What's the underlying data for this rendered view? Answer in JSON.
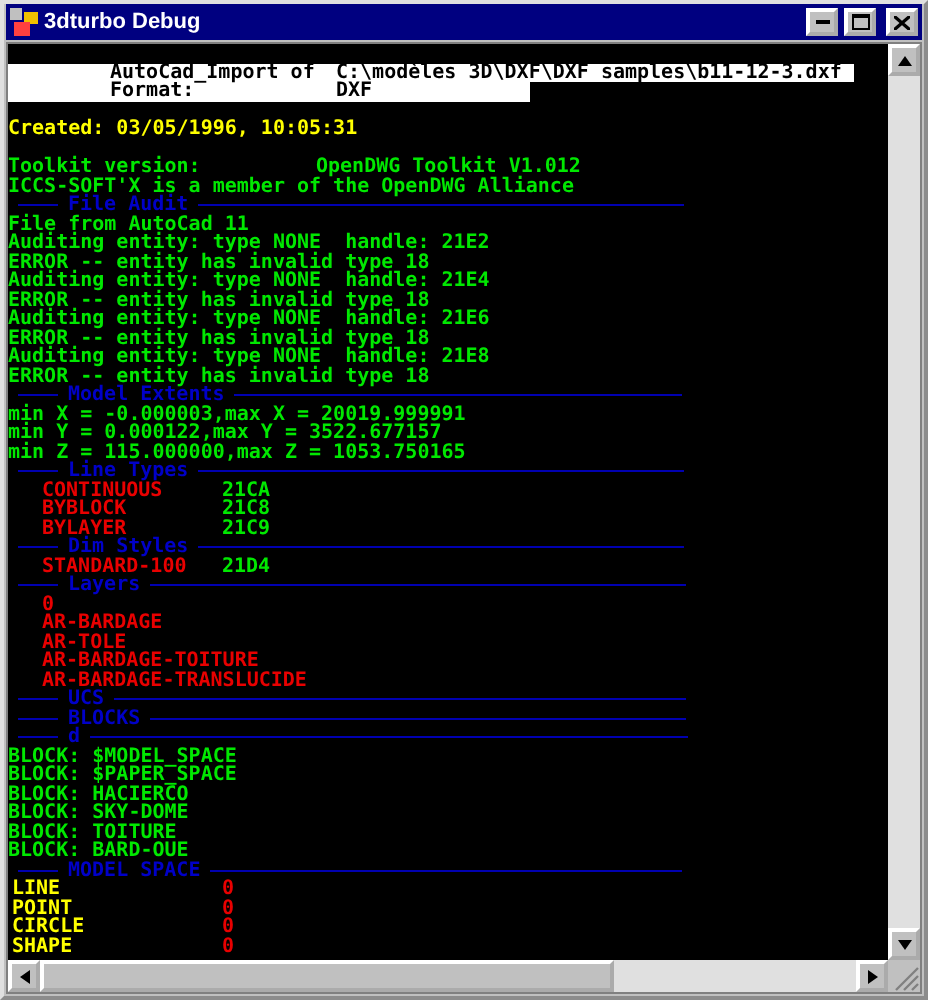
{
  "window": {
    "title": "3dturbo Debug"
  },
  "console": [
    {
      "kind": "blank"
    },
    {
      "kind": "header",
      "label": "AutoCad_Import of",
      "value": "C:\\modèles 3D\\DXF\\DXF samples\\b11-12-3.dxf"
    },
    {
      "kind": "header",
      "label": "Format:",
      "value": "DXF"
    },
    {
      "kind": "blank"
    },
    {
      "kind": "text",
      "text": "Created: 03/05/1996, 10:05:31",
      "color": "#ffff00"
    },
    {
      "kind": "blank"
    },
    {
      "kind": "text",
      "text": "Toolkit version:",
      "value": "OpenDWG Toolkit V1.012",
      "color": "#00e800"
    },
    {
      "kind": "text",
      "text": "ICCS-SOFT'X is a member of the OpenDWG Alliance",
      "color": "#00e800"
    },
    {
      "kind": "section",
      "text": "File Audit"
    },
    {
      "kind": "text",
      "text": "File from AutoCad 11",
      "color": "#00e800"
    },
    {
      "kind": "text",
      "text": "Auditing entity: type NONE  handle: 21E2",
      "color": "#00e800"
    },
    {
      "kind": "text",
      "text": "ERROR -- entity has invalid type 18",
      "color": "#00e800"
    },
    {
      "kind": "text",
      "text": "Auditing entity: type NONE  handle: 21E4",
      "color": "#00e800"
    },
    {
      "kind": "text",
      "text": "ERROR -- entity has invalid type 18",
      "color": "#00e800"
    },
    {
      "kind": "text",
      "text": "Auditing entity: type NONE  handle: 21E6",
      "color": "#00e800"
    },
    {
      "kind": "text",
      "text": "ERROR -- entity has invalid type 18",
      "color": "#00e800"
    },
    {
      "kind": "text",
      "text": "Auditing entity: type NONE  handle: 21E8",
      "color": "#00e800"
    },
    {
      "kind": "text",
      "text": "ERROR -- entity has invalid type 18",
      "color": "#00e800"
    },
    {
      "kind": "section",
      "text": "Model Extents"
    },
    {
      "kind": "text",
      "text": "min X = -0.000003,max X = 20019.999991",
      "color": "#00e800"
    },
    {
      "kind": "text",
      "text": "min Y = 0.000122,max Y = 3522.677157",
      "color": "#00e800"
    },
    {
      "kind": "text",
      "text": "min Z = 115.000000,max Z = 1053.750165",
      "color": "#00e800"
    },
    {
      "kind": "section",
      "text": "Line Types"
    },
    {
      "kind": "entry",
      "text": "CONTINUOUS",
      "value": "21CA"
    },
    {
      "kind": "entry",
      "text": "BYBLOCK",
      "value": "21C8"
    },
    {
      "kind": "entry",
      "text": "BYLAYER",
      "value": "21C9"
    },
    {
      "kind": "section",
      "text": "Dim Styles"
    },
    {
      "kind": "entry",
      "text": "STANDARD-100",
      "value": "21D4"
    },
    {
      "kind": "section",
      "text": "Layers"
    },
    {
      "kind": "entry",
      "text": "0"
    },
    {
      "kind": "entry",
      "text": "AR-BARDAGE"
    },
    {
      "kind": "entry",
      "text": "AR-TOLE"
    },
    {
      "kind": "entry",
      "text": "AR-BARDAGE-TOITURE"
    },
    {
      "kind": "entry",
      "text": "AR-BARDAGE-TRANSLUCIDE"
    },
    {
      "kind": "section",
      "text": "UCS"
    },
    {
      "kind": "section",
      "text": "BLOCKS"
    },
    {
      "kind": "section",
      "text": "d"
    },
    {
      "kind": "text",
      "text": "BLOCK: $MODEL_SPACE",
      "color": "#00e800"
    },
    {
      "kind": "text",
      "text": "BLOCK: $PAPER_SPACE",
      "color": "#00e800"
    },
    {
      "kind": "text",
      "text": "BLOCK: HACIERCO",
      "color": "#00e800"
    },
    {
      "kind": "text",
      "text": "BLOCK: SKY-DOME",
      "color": "#00e800"
    },
    {
      "kind": "text",
      "text": "BLOCK: TOITURE",
      "color": "#00e800"
    },
    {
      "kind": "text",
      "text": "BLOCK: BARD-OUE",
      "color": "#00e800"
    },
    {
      "kind": "section",
      "text": "MODEL SPACE"
    },
    {
      "kind": "count",
      "text": "LINE",
      "value": "0"
    },
    {
      "kind": "count",
      "text": "POINT",
      "value": "0"
    },
    {
      "kind": "count",
      "text": "CIRCLE",
      "value": "0"
    },
    {
      "kind": "count",
      "text": "SHAPE",
      "value": "0"
    }
  ]
}
